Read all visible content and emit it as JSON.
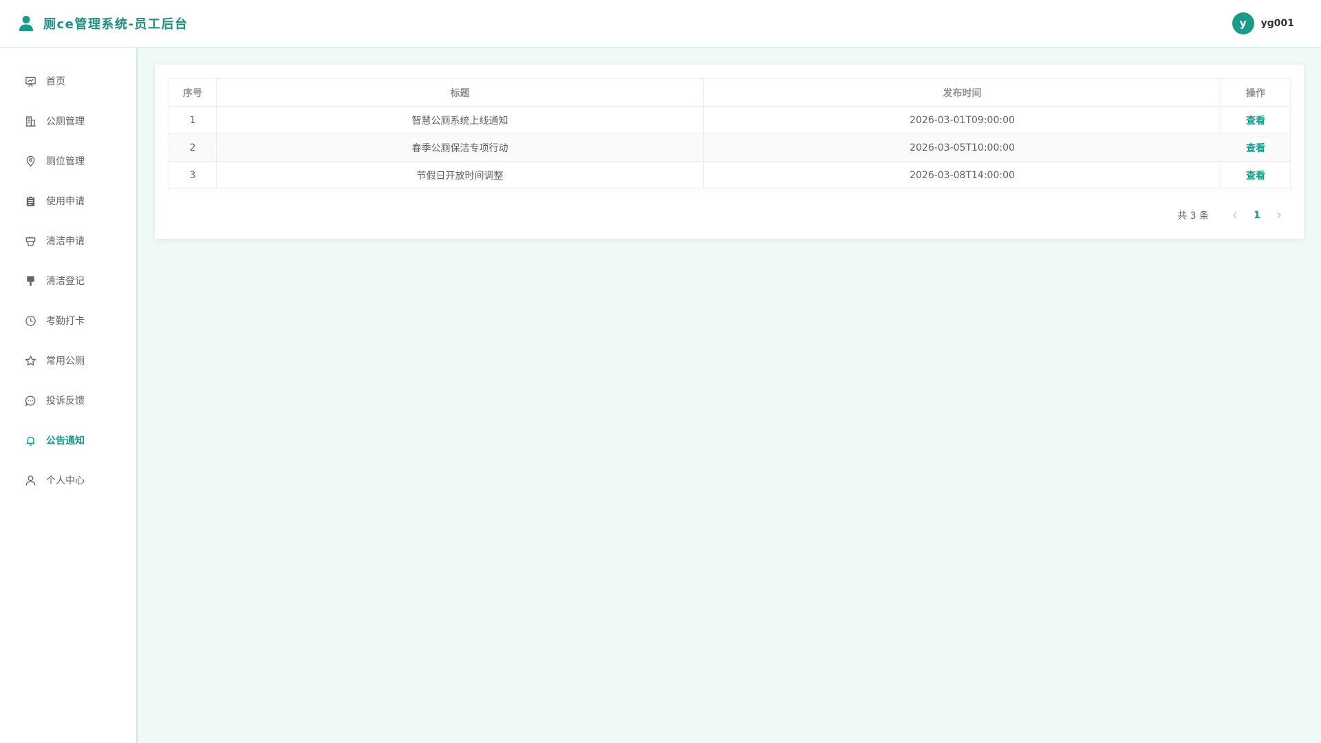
{
  "header": {
    "title": "厕ce管理系统-员工后台",
    "avatar_letter": "y",
    "username": "yg001",
    "logo_icon": "user-icon",
    "accent_color": "#1a9a88"
  },
  "sidebar": {
    "items": [
      {
        "label": "首页",
        "icon": "presentation-icon"
      },
      {
        "label": "公厕管理",
        "icon": "building-icon"
      },
      {
        "label": "厕位管理",
        "icon": "location-pin-icon"
      },
      {
        "label": "使用申请",
        "icon": "clipboard-icon"
      },
      {
        "label": "清洁申请",
        "icon": "cleaning-cart-icon"
      },
      {
        "label": "清洁登记",
        "icon": "paint-brush-icon"
      },
      {
        "label": "考勤打卡",
        "icon": "clock-icon"
      },
      {
        "label": "常用公厕",
        "icon": "star-icon"
      },
      {
        "label": "投诉反馈",
        "icon": "chat-bubble-icon"
      },
      {
        "label": "公告通知",
        "icon": "bell-icon",
        "active": true
      },
      {
        "label": "个人中心",
        "icon": "user-outline-icon"
      }
    ]
  },
  "table": {
    "columns": [
      "序号",
      "标题",
      "发布时间",
      "操作"
    ],
    "rows": [
      {
        "index": "1",
        "title": "智慧公厕系统上线通知",
        "time": "2026-03-01T09:00:00",
        "action": "查看"
      },
      {
        "index": "2",
        "title": "春季公厕保洁专项行动",
        "time": "2026-03-05T10:00:00",
        "action": "查看"
      },
      {
        "index": "3",
        "title": "节假日开放时间调整",
        "time": "2026-03-08T14:00:00",
        "action": "查看"
      }
    ]
  },
  "pagination": {
    "total_text": "共 3 条",
    "current_page": "1"
  }
}
